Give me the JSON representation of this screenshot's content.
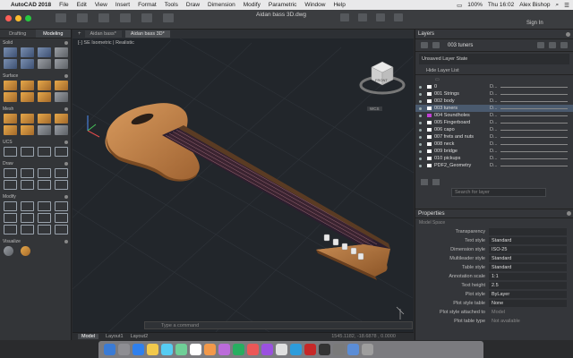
{
  "menubar": {
    "app": "AutoCAD 2018",
    "items": [
      "File",
      "Edit",
      "View",
      "Insert",
      "Format",
      "Tools",
      "Draw",
      "Dimension",
      "Modify",
      "Parametric",
      "Window",
      "Help"
    ],
    "battery": "100%",
    "time": "Thu 16:02",
    "user": "Alex Bishop"
  },
  "window": {
    "title": "Aidan bass 3D.dwg",
    "sign_in": "Sign In"
  },
  "left_panel": {
    "tabs": [
      "Drafting",
      "Modeling"
    ],
    "sections": [
      "Solid",
      "Surface",
      "Mesh",
      "UCS",
      "Draw",
      "Modify",
      "Visualize"
    ]
  },
  "canvas": {
    "file_tabs": [
      "Aidan bass*",
      "Aidan bass 3D*"
    ],
    "viewport_label": "[-]  SE Isometric  |  Realistic",
    "viewcube_label": "WCS",
    "command_placeholder": "Type a command"
  },
  "status": {
    "tabs": [
      "Model",
      "Layout1",
      "Layout2"
    ],
    "coords": "1545.1182, -18.6878 , 0.0000"
  },
  "layers": {
    "title": "Layers",
    "current": "003 tuners",
    "state": "Unsaved Layer State",
    "hide_list": "Hide Layer List",
    "rows": [
      {
        "name": "0",
        "color": "#ffffff"
      },
      {
        "name": "001 Strings",
        "color": "#ffffff"
      },
      {
        "name": "002 body",
        "color": "#ffffff"
      },
      {
        "name": "003 tuners",
        "color": "#ffffff",
        "selected": true
      },
      {
        "name": "004 Soundholes",
        "color": "#c23fd6"
      },
      {
        "name": "005 Fingerboard",
        "color": "#ffffff"
      },
      {
        "name": "006 capo",
        "color": "#ffffff"
      },
      {
        "name": "007 frets and nuts",
        "color": "#ffffff"
      },
      {
        "name": "008 neck",
        "color": "#ffffff"
      },
      {
        "name": "009 bridge",
        "color": "#ffffff"
      },
      {
        "name": "010 pickups",
        "color": "#ffffff"
      },
      {
        "name": "PDF2_Geometry",
        "color": "#ffffff"
      }
    ],
    "row_flag": "D...",
    "search_placeholder": "Search for layer"
  },
  "properties": {
    "title": "Properties",
    "section": "Model Space",
    "rows": [
      {
        "k": "Transparency",
        "v": ""
      },
      {
        "k": "Text style",
        "v": "Standard"
      },
      {
        "k": "Dimension style",
        "v": "ISO-25"
      },
      {
        "k": "Multileader style",
        "v": "Standard"
      },
      {
        "k": "Table style",
        "v": "Standard"
      },
      {
        "k": "Annotation scale",
        "v": "1:1"
      },
      {
        "k": "Text height",
        "v": "2.5"
      },
      {
        "k": "Plot style",
        "v": "ByLayer"
      },
      {
        "k": "Plot style table",
        "v": "None"
      },
      {
        "k": "Plot style attached to",
        "v": "Model",
        "na": true
      },
      {
        "k": "Plot table type",
        "v": "Not available",
        "na": true
      }
    ]
  }
}
